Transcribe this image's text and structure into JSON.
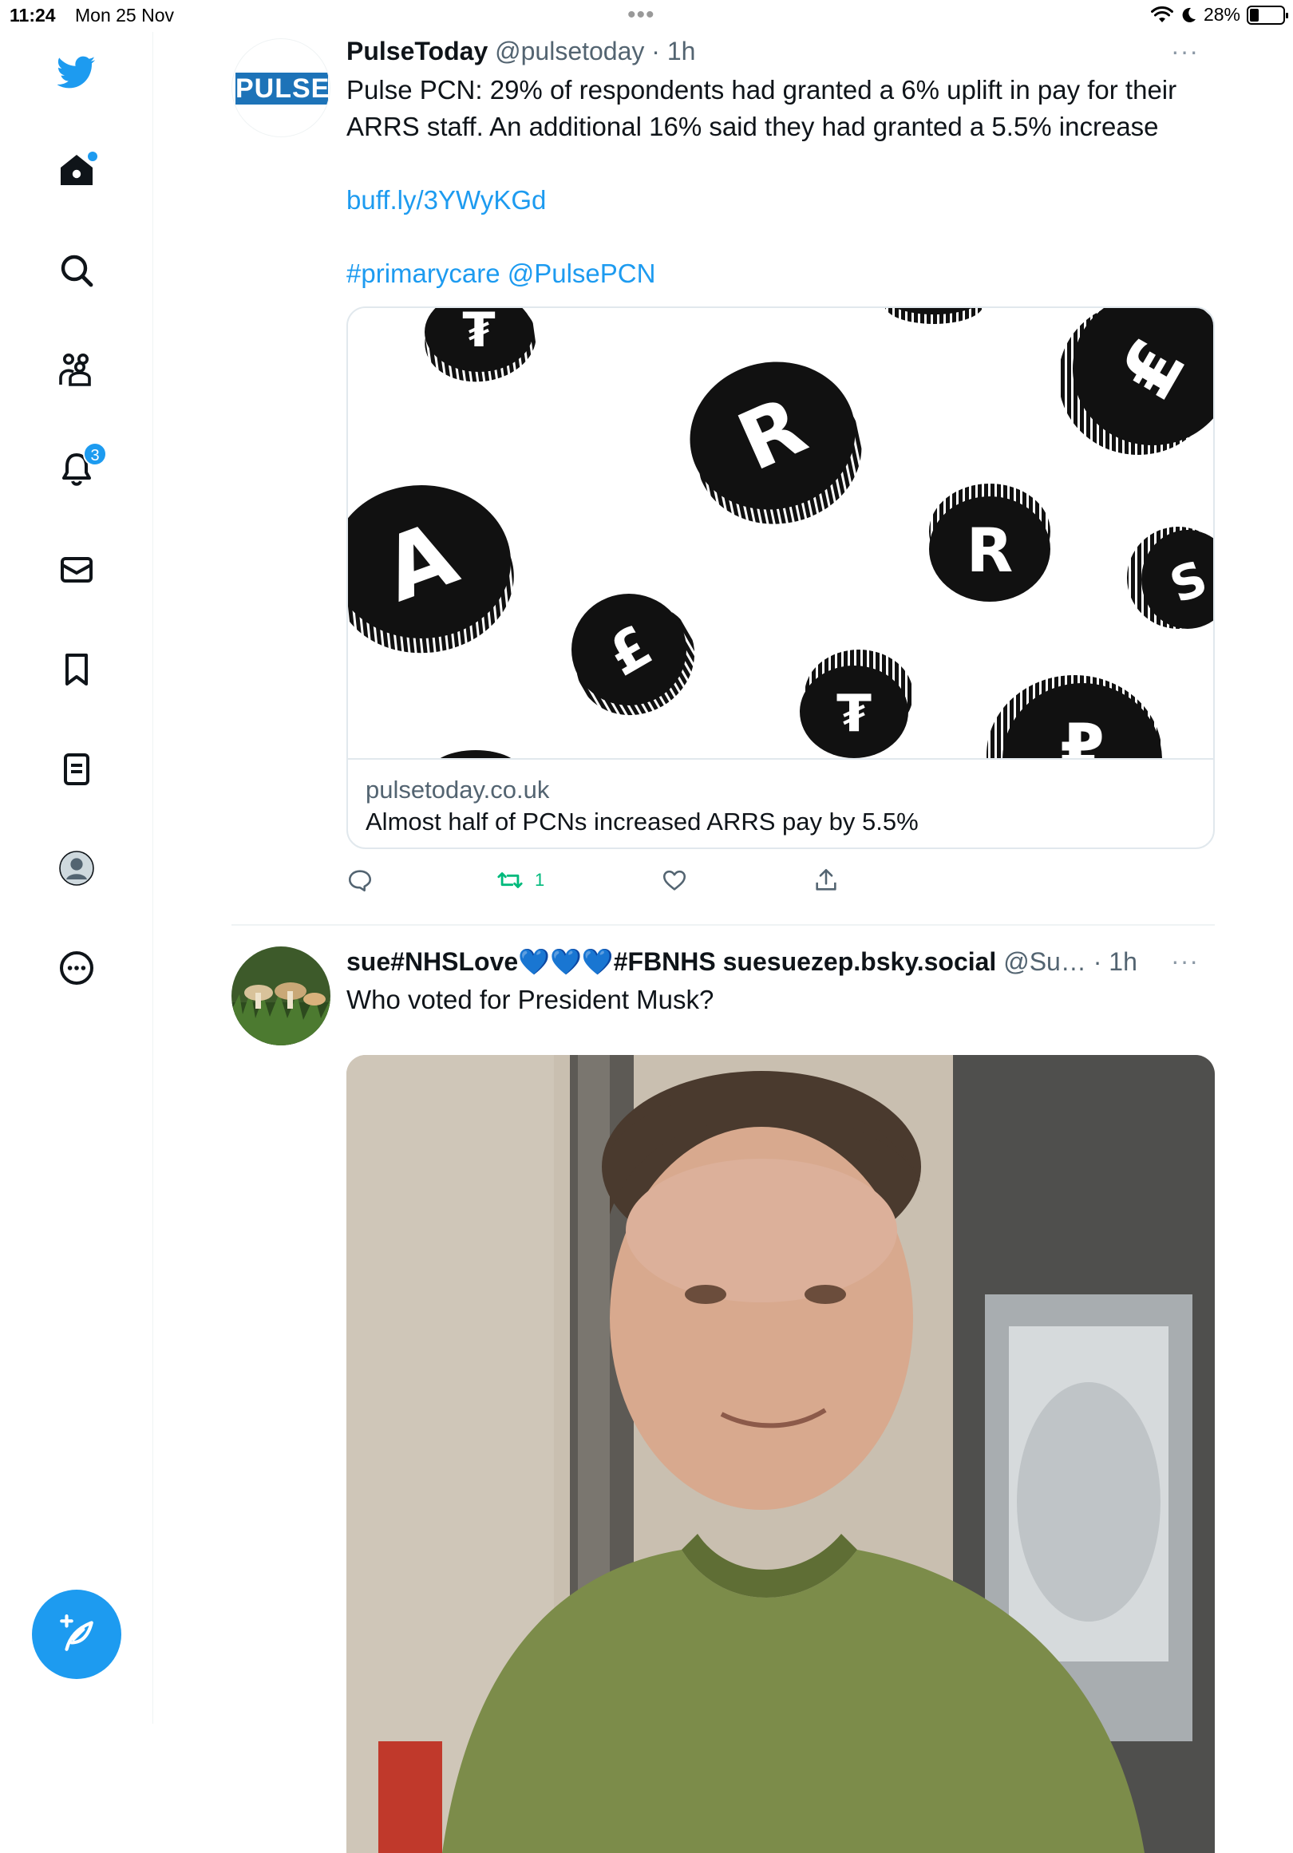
{
  "status_bar": {
    "time": "11:24",
    "date": "Mon 25 Nov",
    "dots": "•••",
    "battery": "28%",
    "battery_level": 0.28
  },
  "sidebar": {
    "notifications_badge": "3",
    "items": [
      "twitter-logo",
      "home-icon",
      "search-icon",
      "communities-icon",
      "notifications-icon",
      "messages-icon",
      "bookmarks-icon",
      "lists-icon",
      "profile-icon",
      "more-icon"
    ],
    "accent": "#1d9bf0"
  },
  "tweet1": {
    "avatar_text": "PULSE",
    "name": "PulseToday",
    "handle": "@pulsetoday",
    "sep": " · ",
    "time": "1h",
    "more": "···",
    "text_line1": "Pulse PCN: 29% of respondents had granted a 6% uplift in pay for their",
    "text_line2": "ARRS staff. An additional 16% said they had granted a 5.5% increase",
    "link": "buff.ly/3YWyKGd",
    "hashtag": "#primarycare",
    "mention": "@PulsePCN",
    "card": {
      "coins": [
        "₮",
        "R",
        "A",
        "£",
        "R",
        "₮",
        "S",
        "₤",
        "₽"
      ],
      "domain": "pulsetoday.co.uk",
      "title": "Almost half of PCNs increased ARRS pay by 5.5%"
    },
    "retweet_count": "1",
    "retweet_color": "#00ba7c"
  },
  "tweet2": {
    "name": "sue#NHSLove💙💙💙#FBNHS suesuezep.bsky.social",
    "handle": "@Su…",
    "sep": " · ",
    "time": "1h",
    "more": "···",
    "text": "Who voted for President Musk?"
  }
}
